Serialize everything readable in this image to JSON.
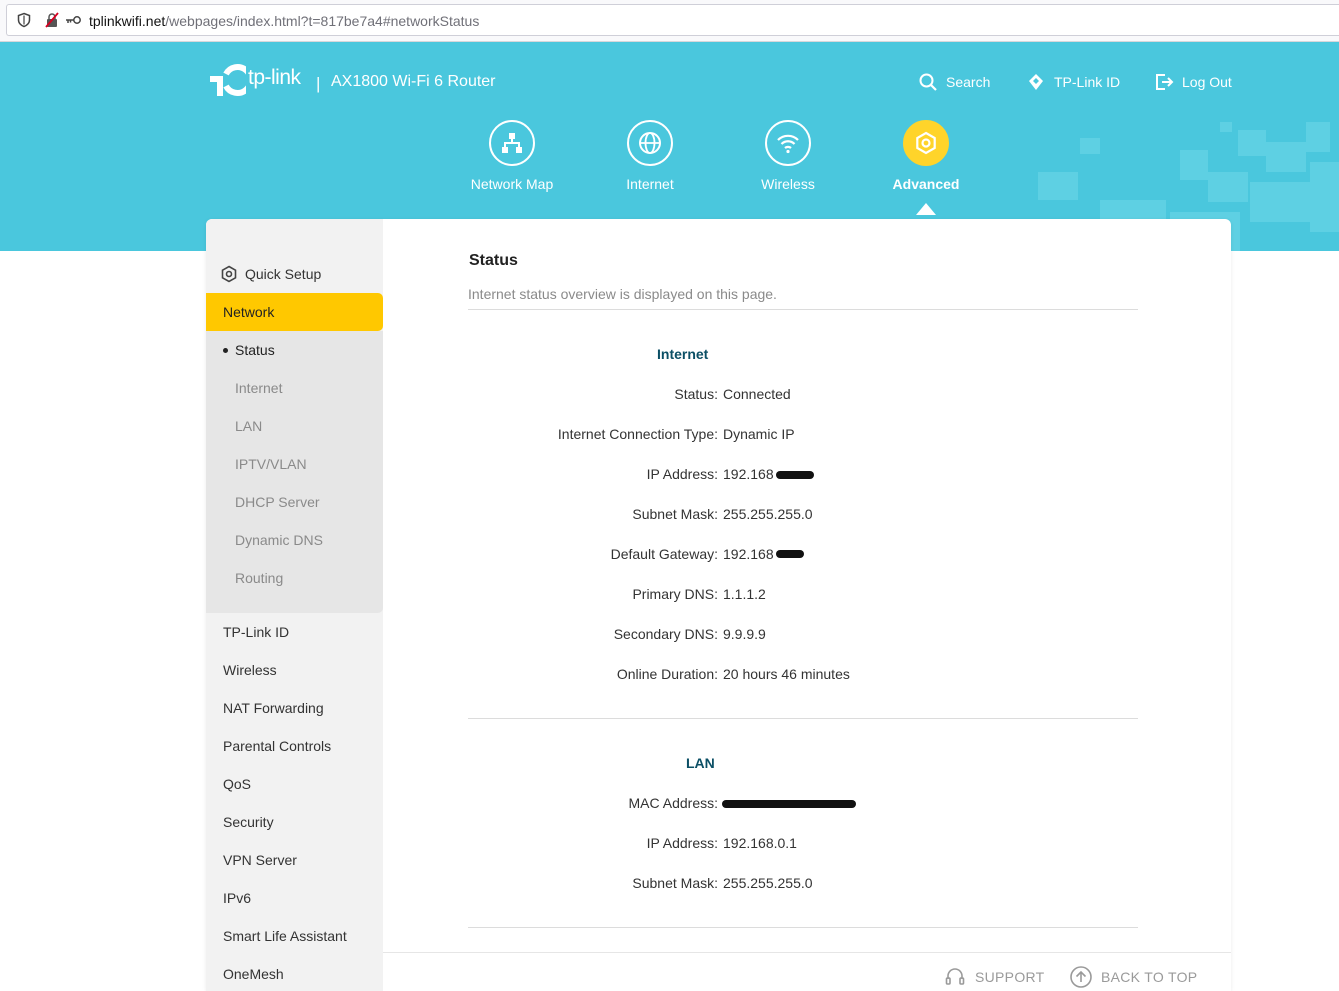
{
  "browser": {
    "url_host": "tplinkwifi.net",
    "url_path": "/webpages/index.html?t=817be7a4#networkStatus",
    "icons": [
      "shield-icon",
      "insecure-lock-icon",
      "key-icon"
    ]
  },
  "header": {
    "brand": "tp-link",
    "separator": "|",
    "model": "AX1800 Wi-Fi 6 Router",
    "top_links": [
      {
        "label": "Search",
        "icon": "search-icon"
      },
      {
        "label": "TP-Link ID",
        "icon": "tplink-id-icon"
      },
      {
        "label": "Log Out",
        "icon": "logout-icon"
      }
    ],
    "nav": [
      {
        "label": "Network Map",
        "icon": "network-map-icon",
        "active": false
      },
      {
        "label": "Internet",
        "icon": "globe-icon",
        "active": false
      },
      {
        "label": "Wireless",
        "icon": "wifi-icon",
        "active": false
      },
      {
        "label": "Advanced",
        "icon": "gear-icon",
        "active": true
      }
    ],
    "colors": {
      "header_bg": "#4ac7dd",
      "accent": "#ffc800"
    }
  },
  "sidebar": {
    "quick_setup": "Quick Setup",
    "network": "Network",
    "sub_items": [
      "Status",
      "Internet",
      "LAN",
      "IPTV/VLAN",
      "DHCP Server",
      "Dynamic DNS",
      "Routing"
    ],
    "active_sub": "Status",
    "items": [
      "TP-Link ID",
      "Wireless",
      "NAT Forwarding",
      "Parental Controls",
      "QoS",
      "Security",
      "VPN Server",
      "IPv6",
      "Smart Life Assistant",
      "OneMesh"
    ]
  },
  "main": {
    "title": "Status",
    "subtitle": "Internet status overview is displayed on this page.",
    "internet": {
      "heading": "Internet",
      "rows": [
        {
          "label": "Status:",
          "value": "Connected"
        },
        {
          "label": "Internet Connection Type:",
          "value": "Dynamic IP"
        },
        {
          "label": "IP Address:",
          "value": "192.168"
        },
        {
          "label": "Subnet Mask:",
          "value": "255.255.255.0"
        },
        {
          "label": "Default Gateway:",
          "value": "192.168"
        },
        {
          "label": "Primary DNS:",
          "value": "1.1.1.2"
        },
        {
          "label": "Secondary DNS:",
          "value": "9.9.9.9"
        },
        {
          "label": "Online Duration:",
          "value": "20 hours 46 minutes"
        }
      ]
    },
    "lan": {
      "heading": "LAN",
      "rows": [
        {
          "label": "MAC Address:",
          "value": ""
        },
        {
          "label": "IP Address:",
          "value": "192.168.0.1"
        },
        {
          "label": "Subnet Mask:",
          "value": "255.255.255.0"
        }
      ]
    }
  },
  "footer": {
    "support": "SUPPORT",
    "back_to_top": "BACK TO TOP"
  }
}
